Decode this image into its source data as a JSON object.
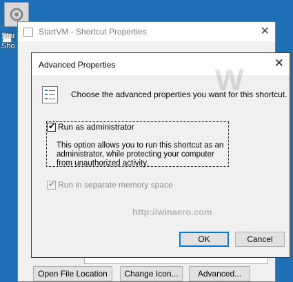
{
  "desktop": {
    "label_line1": "Star",
    "label_line2": "Sho"
  },
  "props_window": {
    "title": "StartVM - Shortcut Properties",
    "close_glyph": "✕",
    "buttons": {
      "open_file_location": "Open File Location",
      "change_icon": "Change Icon...",
      "advanced": "Advanced..."
    }
  },
  "advanced_dialog": {
    "title": "Advanced Properties",
    "close_glyph": "✕",
    "intro": "Choose the advanced properties you want for this shortcut.",
    "run_as_admin": {
      "label": "Run as administrator",
      "checked": true,
      "description": "This option allows you to run this shortcut as an administrator, while protecting your computer from unauthorized activity."
    },
    "separate_memory": {
      "label": "Run in separate memory space",
      "checked": true,
      "disabled": true
    },
    "buttons": {
      "ok": "OK",
      "cancel": "Cancel"
    }
  },
  "watermark": {
    "text": "http://winaero.com",
    "logo_letter": "W"
  },
  "colors": {
    "desktop": "#1f6fb6",
    "accent": "#0078d7"
  }
}
